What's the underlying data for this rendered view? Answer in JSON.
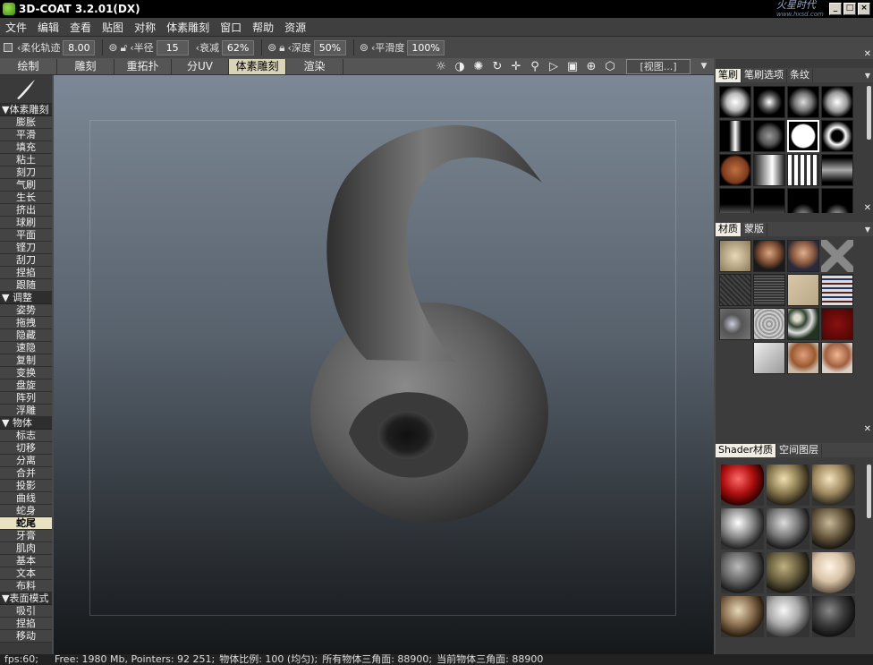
{
  "app": {
    "title": "3D-COAT 3.2.01(DX)",
    "brand": "火星时代",
    "brand_sub": "www.hxsd.com"
  },
  "window_buttons": [
    "_",
    "□",
    "×"
  ],
  "menu": [
    "文件",
    "编辑",
    "查看",
    "贴图",
    "对称",
    "体素雕刻",
    "窗口",
    "帮助",
    "资源"
  ],
  "tool_options": {
    "soft_trail": {
      "label": "柔化轨迹",
      "value": "8.00"
    },
    "radius": {
      "label": "半径",
      "value": "15"
    },
    "falloff": {
      "label": "衰减",
      "value": "62%"
    },
    "depth": {
      "label": "深度",
      "value": "50%"
    },
    "smooth": {
      "label": "平滑度",
      "value": "100%"
    }
  },
  "tabs": [
    "绘制",
    "雕刻",
    "重拓扑",
    "分UV",
    "体素雕刻",
    "渲染"
  ],
  "active_tab": "体素雕刻",
  "view_menu": "[视图...]",
  "view_tool_icons": [
    "sun-icon",
    "half-circle-icon",
    "light-icon",
    "rotate-icon",
    "move-icon",
    "zoom-icon",
    "select-icon",
    "frame-icon",
    "target-icon",
    "cube-icon"
  ],
  "left_panel": {
    "sections": [
      {
        "title": "▼体素雕刻",
        "items": [
          "膨胀",
          "平滑",
          "填充",
          "粘土",
          "刻刀",
          "气刷",
          "生长",
          "挤出",
          "球刷",
          "平面",
          "铿刀",
          "刮刀",
          "捏掐",
          "跟随"
        ]
      },
      {
        "title": "▼    调整",
        "items": [
          "姿势",
          "拖拽",
          "隐藏",
          "速隐",
          "复制",
          "变换",
          "盘旋",
          "阵列",
          "浮雕"
        ]
      },
      {
        "title": "▼    物体",
        "items": [
          "标志",
          "切移",
          "分离",
          "合并",
          "投影",
          "曲线",
          "蛇身",
          "蛇尾",
          "牙膏",
          "肌肉",
          "基本",
          "文本",
          "布料"
        ]
      },
      {
        "title": "▼表面模式",
        "items": [
          "吸引",
          "捏掐",
          "移动"
        ]
      }
    ],
    "active_item": "蛇尾"
  },
  "brush_panel": {
    "tabs": [
      "笔刷",
      "笔刷选项",
      "条纹"
    ],
    "active": "笔刷"
  },
  "material_panel": {
    "tabs": [
      "材质",
      "蒙版"
    ],
    "active": "材质"
  },
  "shader_panel": {
    "tabs": [
      "Shader材质",
      "空间图层"
    ],
    "active": "Shader材质"
  },
  "colors": {
    "accent": "#d9d3b8",
    "viewport_top": "#7c8895",
    "viewport_bottom": "#15181a"
  },
  "status": {
    "fps": "fps:60;",
    "free": "Free: 1980 Mb, Pointers: 92 251;",
    "scale": "物体比例: 100 (均匀);",
    "all_tris": "所有物体三角面: 88900;",
    "cur_tris": "当前物体三角面: 88900"
  }
}
